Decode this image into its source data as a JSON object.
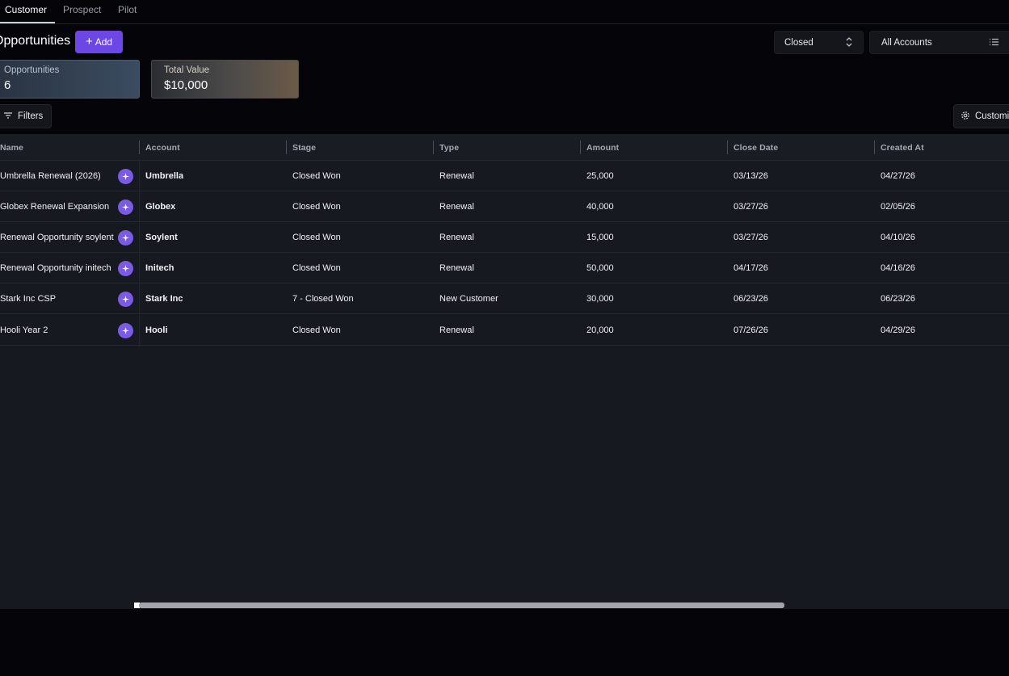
{
  "tabs": [
    {
      "label": "Customer",
      "active": true
    },
    {
      "label": "Prospect",
      "active": false
    },
    {
      "label": "Pilot",
      "active": false
    }
  ],
  "header": {
    "title": "Opportunities",
    "add_label": "Add",
    "status_select": "Closed",
    "accounts_select": "All Accounts"
  },
  "cards": {
    "opportunities_label": "Opportunities",
    "opportunities_value": "6",
    "total_value_label": "Total Value",
    "total_value_value": "$10,000"
  },
  "toolbar": {
    "filters_label": "Filters",
    "customize_label": "Customize"
  },
  "table": {
    "columns": [
      "Name",
      "Account",
      "Stage",
      "Type",
      "Amount",
      "Close Date",
      "Created At"
    ],
    "rows": [
      {
        "name": "Umbrella Renewal (2026)",
        "account": "Umbrella",
        "stage": "Closed Won",
        "type": "Renewal",
        "amount": "25,000",
        "close_date": "03/13/26",
        "created_at": "04/27/26"
      },
      {
        "name": "Globex Renewal Expansion",
        "account": "Globex",
        "stage": "Closed Won",
        "type": "Renewal",
        "amount": "40,000",
        "close_date": "03/27/26",
        "created_at": "02/05/26"
      },
      {
        "name": "Renewal Opportunity soylent",
        "account": "Soylent",
        "stage": "Closed Won",
        "type": "Renewal",
        "amount": "15,000",
        "close_date": "03/27/26",
        "created_at": "04/10/26"
      },
      {
        "name": "Renewal Opportunity initech",
        "account": "Initech",
        "stage": "Closed Won",
        "type": "Renewal",
        "amount": "50,000",
        "close_date": "04/17/26",
        "created_at": "04/16/26"
      },
      {
        "name": "Stark Inc CSP",
        "account": "Stark Inc",
        "stage": "7 - Closed Won",
        "type": "New Customer",
        "amount": "30,000",
        "close_date": "06/23/26",
        "created_at": "06/23/26"
      },
      {
        "name": "Hooli Year 2",
        "account": "Hooli",
        "stage": "Closed Won",
        "type": "Renewal",
        "amount": "20,000",
        "close_date": "07/26/26",
        "created_at": "04/29/26"
      }
    ]
  },
  "colors": {
    "accent": "#6c47e6",
    "background": "#050509",
    "table_bg": "#171920"
  },
  "icons": {
    "add": "plus-icon",
    "status_select": "chevron-up-down-icon",
    "accounts_select": "list-icon",
    "filters": "filter-icon",
    "customize": "gear-icon",
    "row_action": "sparkle-icon"
  }
}
